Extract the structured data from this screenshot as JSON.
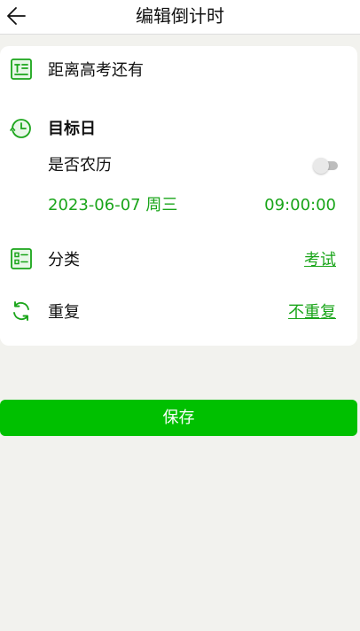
{
  "header": {
    "back_icon": "arrow-left-icon",
    "title": "编辑倒计时"
  },
  "card": {
    "name_row": {
      "icon": "text-box-icon",
      "text": "距离高考还有"
    },
    "target_day": {
      "icon": "clock-history-icon",
      "label": "目标日",
      "lunar_label": "是否农历",
      "lunar_enabled": false,
      "date": "2023-06-07 周三",
      "time": "09:00:00"
    },
    "category": {
      "icon": "list-icon",
      "label": "分类",
      "value": "考试"
    },
    "repeat": {
      "icon": "refresh-icon",
      "label": "重复",
      "value": "不重复"
    }
  },
  "actions": {
    "save_label": "保存"
  },
  "colors": {
    "accent": "#1aa51a",
    "button": "#00c000",
    "background": "#f2f2ee"
  }
}
